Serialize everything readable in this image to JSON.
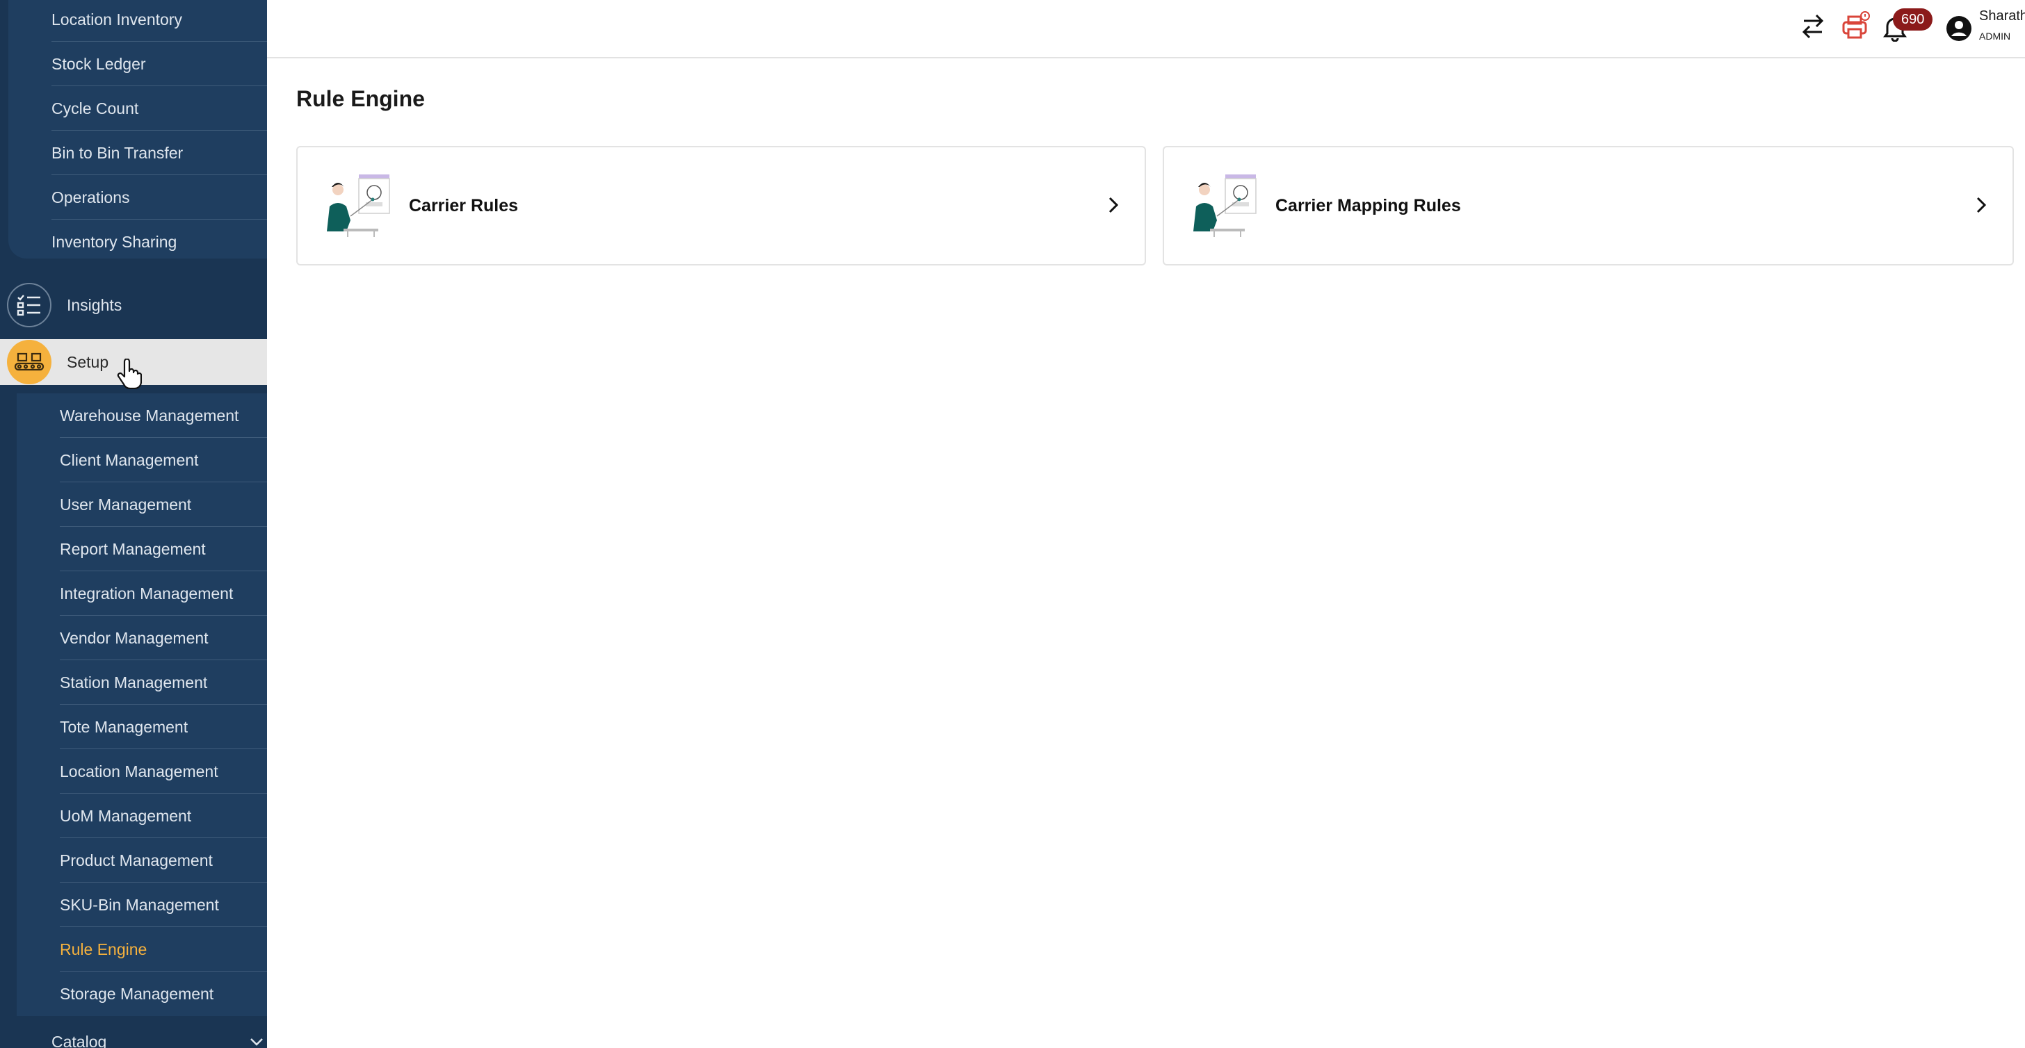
{
  "sidebar": {
    "top_items": [
      {
        "label": "Location Inventory"
      },
      {
        "label": "Stock Ledger"
      },
      {
        "label": "Cycle Count"
      },
      {
        "label": "Bin to Bin Transfer"
      },
      {
        "label": "Operations"
      },
      {
        "label": "Inventory Sharing"
      }
    ],
    "insights": {
      "label": "Insights",
      "icon": "checklist-icon"
    },
    "setup": {
      "label": "Setup",
      "icon": "conveyor-icon"
    },
    "setup_items": [
      {
        "label": "Warehouse Management"
      },
      {
        "label": "Client Management"
      },
      {
        "label": "User Management"
      },
      {
        "label": "Report Management"
      },
      {
        "label": "Integration Management"
      },
      {
        "label": "Vendor Management"
      },
      {
        "label": "Station Management"
      },
      {
        "label": "Tote Management"
      },
      {
        "label": "Location Management"
      },
      {
        "label": "UoM Management"
      },
      {
        "label": "Product Management"
      },
      {
        "label": "SKU-Bin Management"
      },
      {
        "label": "Rule Engine",
        "active": true
      },
      {
        "label": "Storage Management"
      }
    ],
    "catalog": {
      "label": "Catalog"
    }
  },
  "topbar": {
    "notification_count": "690",
    "user_name": "Sharath",
    "user_role": "ADMIN"
  },
  "page": {
    "title": "Rule Engine",
    "cards": [
      {
        "title": "Carrier Rules"
      },
      {
        "title": "Carrier Mapping Rules"
      }
    ]
  },
  "colors": {
    "sidebar_bg": "#1a3553",
    "accent": "#f5b13d",
    "badge": "#8b1a1a",
    "printer_icon": "#d9453a"
  }
}
